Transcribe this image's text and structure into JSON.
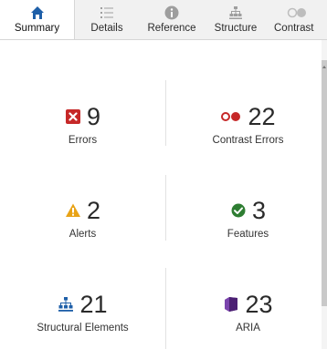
{
  "tabs": [
    {
      "label": "Summary",
      "icon": "home-icon",
      "active": true
    },
    {
      "label": "Details",
      "icon": "list-icon",
      "active": false
    },
    {
      "label": "Reference",
      "icon": "info-icon",
      "active": false
    },
    {
      "label": "Structure",
      "icon": "hierarchy-icon",
      "active": false
    },
    {
      "label": "Contrast",
      "icon": "contrast-icon",
      "active": false
    }
  ],
  "summary": {
    "errors": {
      "count": "9",
      "label": "Errors",
      "icon": "error-x-icon",
      "color": "#c62828"
    },
    "contrast_errors": {
      "count": "22",
      "label": "Contrast Errors",
      "icon": "contrast-error-icon",
      "color": "#c62828"
    },
    "alerts": {
      "count": "2",
      "label": "Alerts",
      "icon": "alert-triangle-icon",
      "color": "#e8a317"
    },
    "features": {
      "count": "3",
      "label": "Features",
      "icon": "feature-check-icon",
      "color": "#2e7d32"
    },
    "structural": {
      "count": "21",
      "label": "Structural Elements",
      "icon": "structure-icon",
      "color": "#1e5fa8"
    },
    "aria": {
      "count": "23",
      "label": "ARIA",
      "icon": "aria-cube-icon",
      "color": "#5e2a8c"
    }
  },
  "colors": {
    "tab_icon_active": "#1e5fa8",
    "tab_icon_inactive": "#9e9e9e",
    "tab_bar_bg": "#f1f1f1"
  }
}
